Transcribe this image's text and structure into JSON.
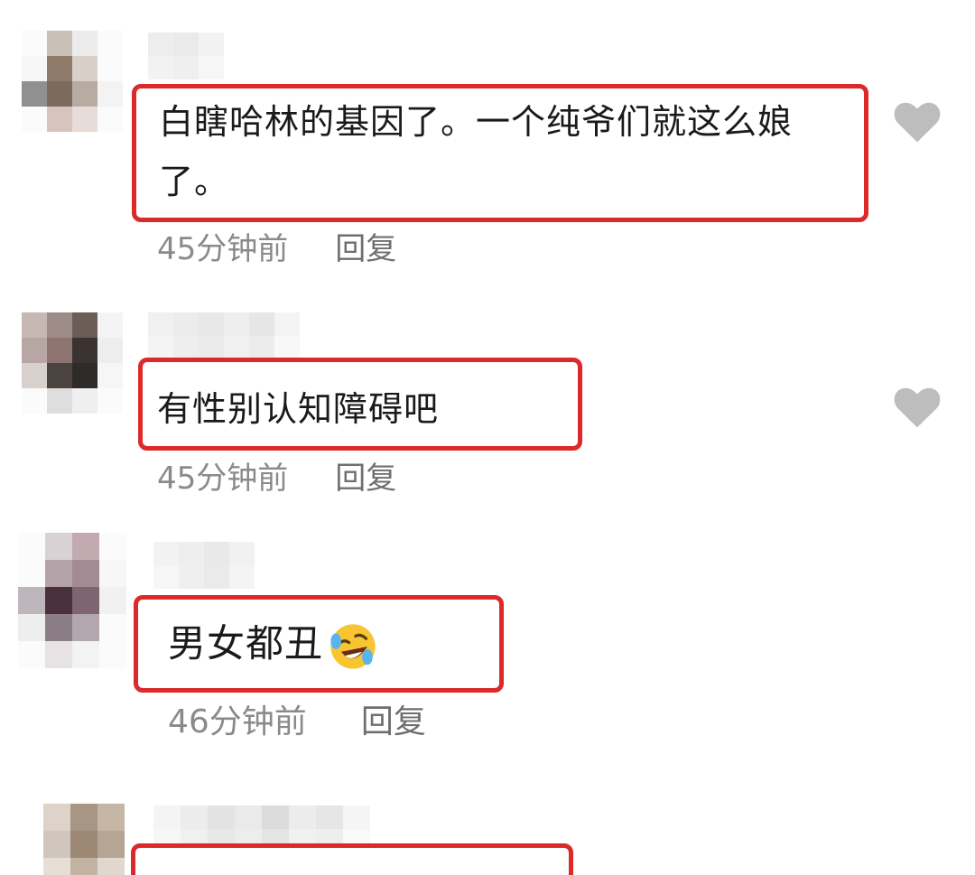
{
  "comments": [
    {
      "text": "白瞎哈林的基因了。一个纯爷们就这么娘了。",
      "time": "45分钟前",
      "reply": "回复",
      "liked": false
    },
    {
      "text": "有性别认知障碍吧",
      "time": "45分钟前",
      "reply": "回复",
      "liked": false
    },
    {
      "text": "男女都丑",
      "emoji": "rolling-on-floor-laughing-icon",
      "time": "46分钟前",
      "reply": "回复"
    },
    {
      "text": ""
    }
  ],
  "colors": {
    "highlight_border": "#dc2a2a",
    "meta_text": "#8a8a8a",
    "like_icon": "#bdbdbd"
  }
}
